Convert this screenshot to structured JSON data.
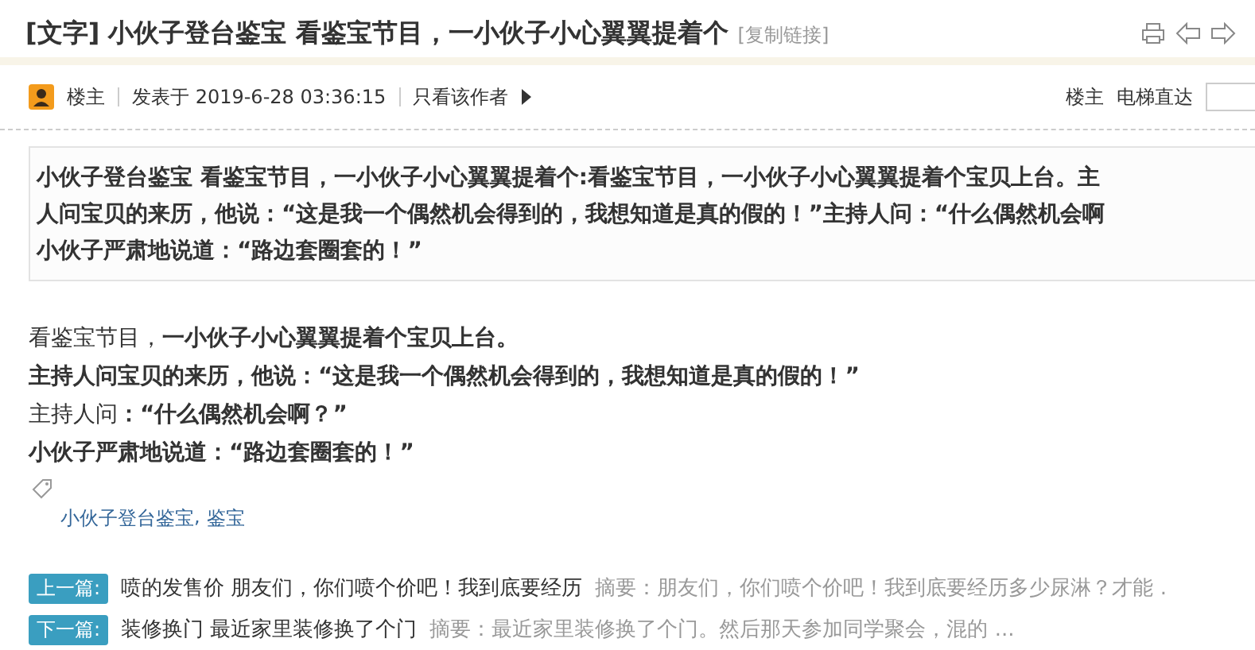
{
  "title": {
    "category": "[文字]",
    "text": "小伙子登台鉴宝 看鉴宝节目，一小伙子小心翼翼提着个",
    "copy_link": "[复制链接]"
  },
  "post_meta": {
    "author": "楼主",
    "posted": "发表于 2019-6-28 03:36:15",
    "only_author": "只看该作者",
    "floor": "楼主",
    "jump_label": "电梯直达"
  },
  "summary_lines": [
    "小伙子登台鉴宝 看鉴宝节目，一小伙子小心翼翼提着个:看鉴宝节目，一小伙子小心翼翼提着个宝贝上台。主",
    "人问宝贝的来历，他说：“这是我一个偶然机会得到的，我想知道是真的假的！”主持人问：“什么偶然机会啊",
    "小伙子严肃地说道：“路边套圈套的！”"
  ],
  "story_lines": [
    "看鉴宝节目，**一小伙子小心翼翼提着个宝贝上台。**",
    "**主持人问宝贝的来历，他说：“这是我一个偶然机会得到的，我想知道是真的假的！”**",
    "主持人问**：“什么偶然机会啊？”**",
    "**小伙子严肃地说道：“路边套圈套的！”**"
  ],
  "tags": {
    "items": [
      "小伙子登台鉴宝",
      "鉴宝"
    ],
    "separator": ","
  },
  "nav": [
    {
      "label": "上一篇:",
      "title": "喷的发售价 朋友们，你们喷个价吧！我到底要经历",
      "summary": "摘要：朋友们，你们喷个价吧！我到底要经历多少尿淋？才能 ."
    },
    {
      "label": "下一篇:",
      "title": "装修换门 最近家里装修换了个门",
      "summary": "摘要：最近家里装修换了个门。然后那天参加同学聚会，混的 ..."
    }
  ]
}
